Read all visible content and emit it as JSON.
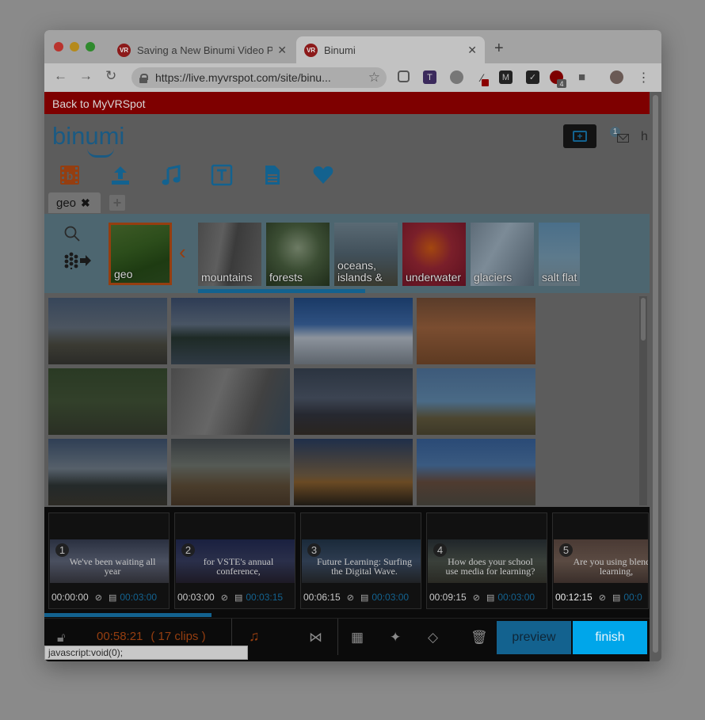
{
  "browser": {
    "tabs": [
      {
        "title": "Saving a New Binumi Video Pro",
        "favicon": "VR"
      },
      {
        "title": "Binumi",
        "favicon": "VR"
      }
    ],
    "url": "https://live.myvrspot.com/site/binu...",
    "extension_badge": "4"
  },
  "page": {
    "back_link": "Back to MyVRSpot",
    "logo": "binumi",
    "message_count": "1",
    "user_initial": "h",
    "active_tab": "geo",
    "categories": [
      {
        "label": "geo",
        "selected": true
      },
      {
        "label": "mountains"
      },
      {
        "label": "forests"
      },
      {
        "label": "oceans, islands &"
      },
      {
        "label": "underwater"
      },
      {
        "label": "glaciers"
      },
      {
        "label": "salt flat"
      }
    ],
    "timeline": {
      "clips": [
        {
          "num": "1",
          "caption": "We've been waiting all year",
          "start": "00:00:00",
          "duration": "00:03:00"
        },
        {
          "num": "2",
          "caption": "for VSTE's annual conference,",
          "start": "00:03:00",
          "duration": "00:03:15"
        },
        {
          "num": "3",
          "caption": "Future Learning: Surfing the Digital Wave.",
          "start": "00:06:15",
          "duration": "00:03:00"
        },
        {
          "num": "4",
          "caption": "How does your school use media for learning?",
          "start": "00:09:15",
          "duration": "00:03:00"
        },
        {
          "num": "5",
          "caption": "Are you using blended learning,",
          "start": "00:12:15",
          "duration": "00:0"
        }
      ],
      "total_time": "00:58:21",
      "clip_count": "( 17 clips )"
    },
    "buttons": {
      "preview": "preview",
      "finish": "finish"
    },
    "status_text": "javascript:void(0);"
  },
  "colors": {
    "accent": "#00a6ea",
    "brand_orange": "#953e10",
    "backbar": "#7e0000"
  }
}
